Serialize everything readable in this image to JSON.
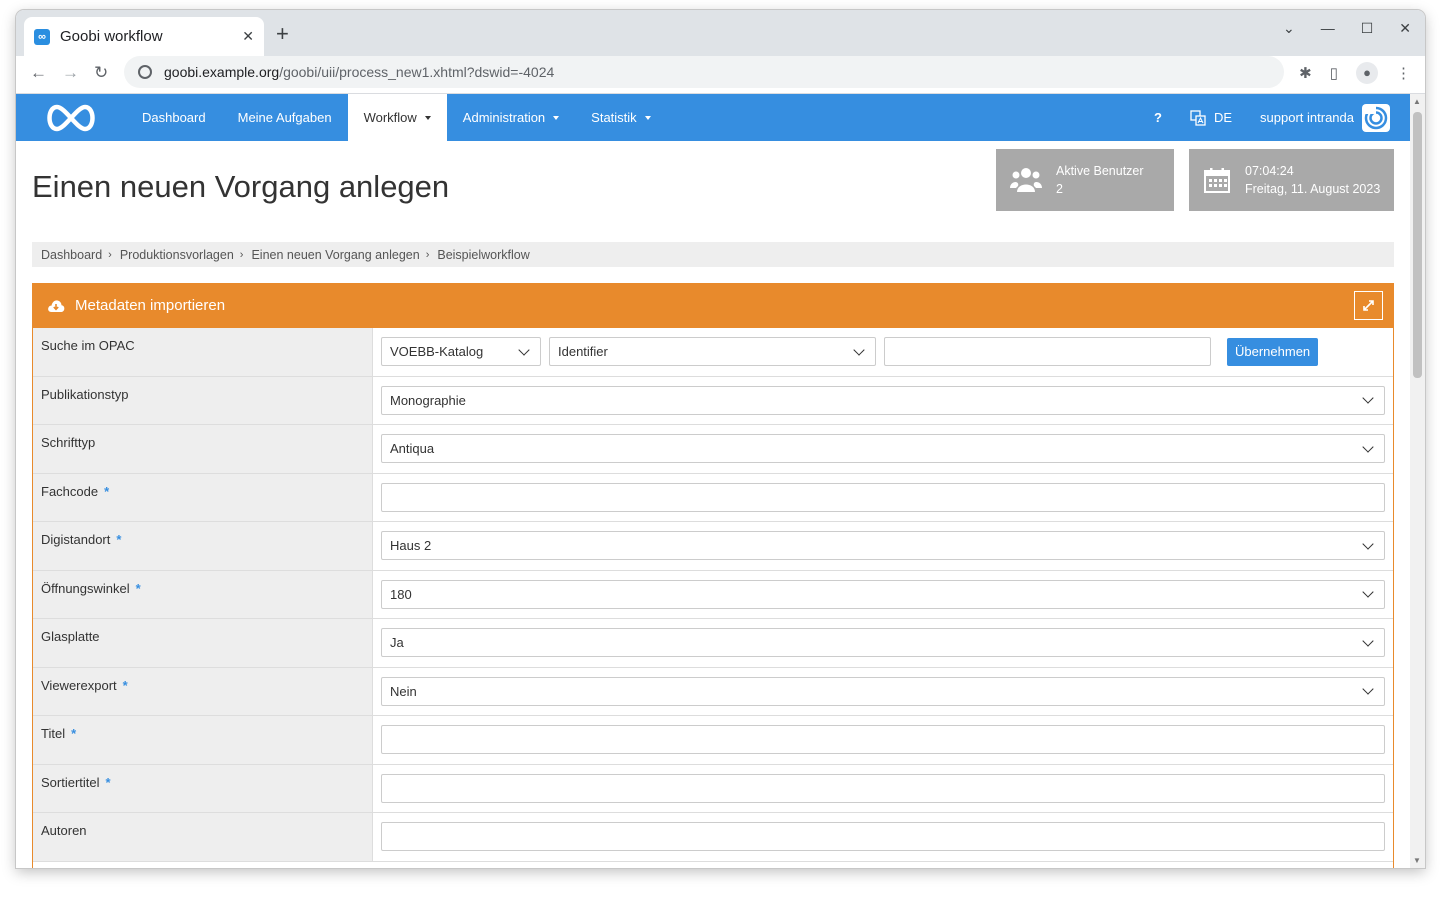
{
  "browser": {
    "tab_title": "Goobi workflow",
    "url_host": "goobi.example.org",
    "url_path": "/goobi/uii/process_new1.xhtml?dswid=-4024"
  },
  "navbar": {
    "items": [
      {
        "label": "Dashboard"
      },
      {
        "label": "Meine Aufgaben"
      },
      {
        "label": "Workflow"
      },
      {
        "label": "Administration"
      },
      {
        "label": "Statistik"
      }
    ],
    "help_label": "?",
    "language_label": "DE",
    "user_label": "support intranda",
    "accent_color": "#368ee0"
  },
  "header": {
    "title": "Einen neuen Vorgang anlegen",
    "active_users_label": "Aktive Benutzer",
    "active_users_count": "2",
    "time": "07:04:24",
    "date": "Freitag, 11. August 2023"
  },
  "breadcrumb": [
    "Dashboard",
    "Produktionsvorlagen",
    "Einen neuen Vorgang anlegen",
    "Beispielworkflow"
  ],
  "box": {
    "title": "Metadaten importieren",
    "header_color": "#e88a2c"
  },
  "form": {
    "opac": {
      "label": "Suche im OPAC",
      "catalog": "VOEBB-Katalog",
      "field": "Identifier",
      "query": "",
      "button": "Übernehmen"
    },
    "rows": [
      {
        "label": "Publikationstyp",
        "required": false,
        "type": "select",
        "value": "Monographie"
      },
      {
        "label": "Schrifttyp",
        "required": false,
        "type": "select",
        "value": "Antiqua"
      },
      {
        "label": "Fachcode",
        "required": true,
        "type": "input",
        "value": ""
      },
      {
        "label": "Digistandort",
        "required": true,
        "type": "select",
        "value": "Haus 2"
      },
      {
        "label": "Öffnungswinkel",
        "required": true,
        "type": "select",
        "value": "180"
      },
      {
        "label": "Glasplatte",
        "required": false,
        "type": "select",
        "value": "Ja"
      },
      {
        "label": "Viewerexport",
        "required": true,
        "type": "select",
        "value": "Nein"
      },
      {
        "label": "Titel",
        "required": true,
        "type": "input",
        "value": ""
      },
      {
        "label": "Sortiertitel",
        "required": true,
        "type": "input",
        "value": ""
      },
      {
        "label": "Autoren",
        "required": false,
        "type": "input",
        "value": ""
      }
    ],
    "required_marker": "*"
  }
}
